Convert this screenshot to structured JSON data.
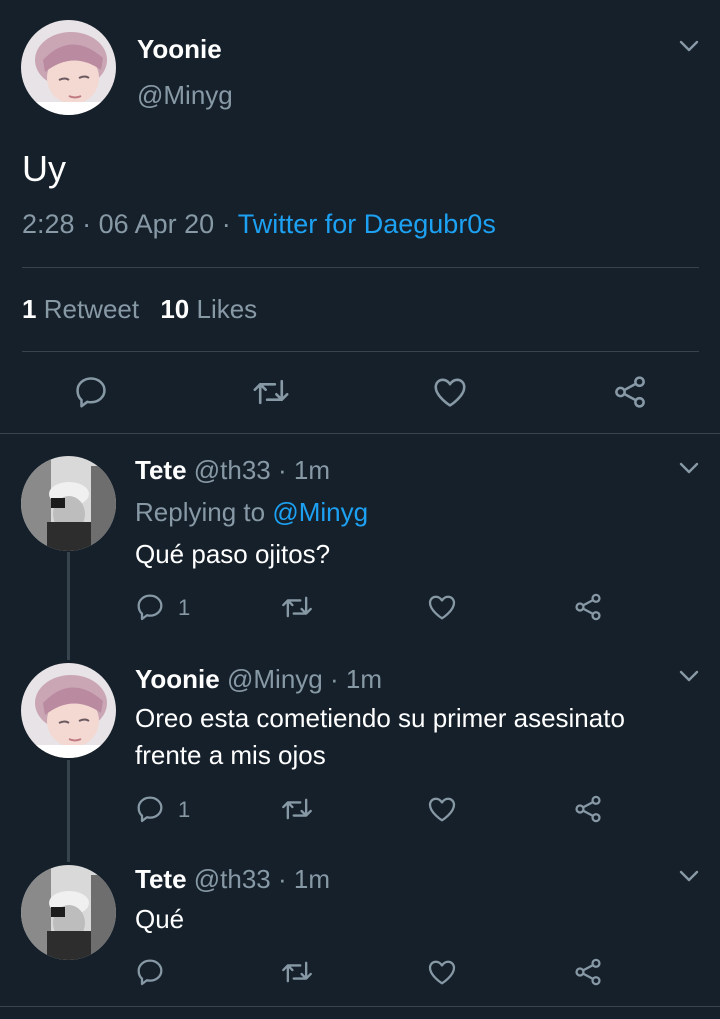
{
  "main_tweet": {
    "name": "Yoonie",
    "handle": "@Minyg",
    "text": "Uy",
    "time": "2:28",
    "sep1": "·",
    "date": "06 Apr 20",
    "sep2": "·",
    "source": "Twitter for Daegubr0s",
    "retweets_count": "1",
    "retweets_label": "Retweet",
    "likes_count": "10",
    "likes_label": "Likes"
  },
  "replies": [
    {
      "name": "Tete",
      "handle": "@th33",
      "dot": "·",
      "time": "1m",
      "replying_prefix": "Replying to",
      "replying_handle": "@Minyg",
      "text": "Qué paso ojitos?",
      "reply_count": "1"
    },
    {
      "name": "Yoonie",
      "handle": "@Minyg",
      "dot": "·",
      "time": "1m",
      "text_line1": "Oreo esta cometiendo su primer asesinato",
      "text_line2": "frente a mis ojos",
      "reply_count": "1"
    },
    {
      "name": "Tete",
      "handle": "@th33",
      "dot": "·",
      "time": "1m",
      "text": "Qué",
      "reply_count": ""
    }
  ],
  "colors": {
    "background": "#15202b",
    "muted": "#8899a6",
    "link": "#1da1f2",
    "divider": "#38444d"
  }
}
